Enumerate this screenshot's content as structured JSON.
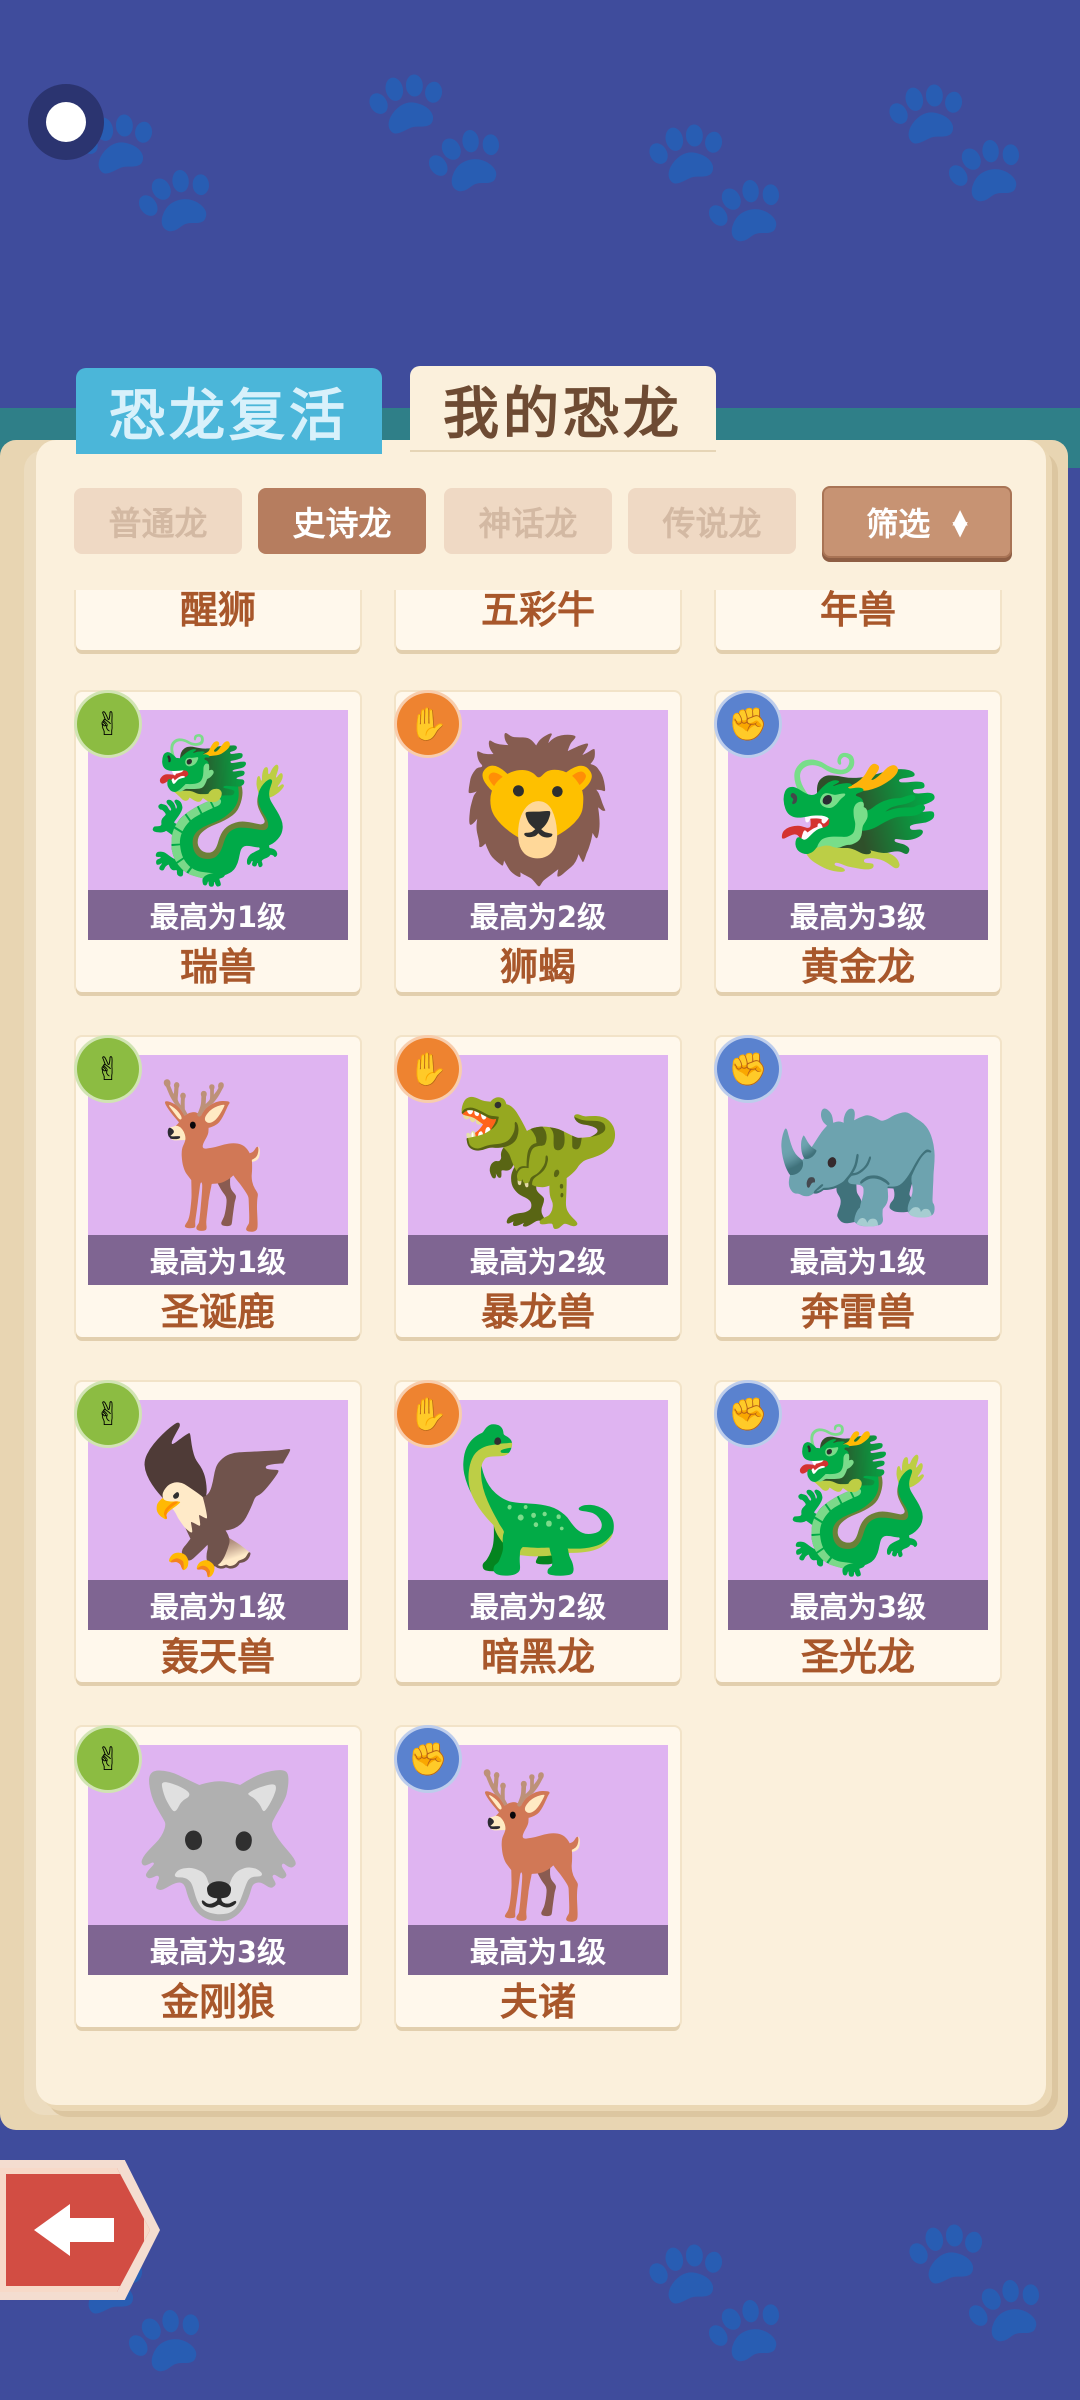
{
  "tabs": {
    "revive": "恐龙复活",
    "mine": "我的恐龙"
  },
  "subtabs": [
    "普通龙",
    "史诗龙",
    "神话龙",
    "传说龙"
  ],
  "active_subtab": "史诗龙",
  "filter_label": "筛选",
  "partial_row": [
    "醒狮",
    "五彩牛",
    "年兽"
  ],
  "cards": [
    {
      "name": "瑞兽",
      "level": "最高为1级",
      "type": "scissors",
      "icon": "🐉"
    },
    {
      "name": "狮蝎",
      "level": "最高为2级",
      "type": "paper",
      "icon": "🦁"
    },
    {
      "name": "黄金龙",
      "level": "最高为3级",
      "type": "rock",
      "icon": "🐲"
    },
    {
      "name": "圣诞鹿",
      "level": "最高为1级",
      "type": "scissors",
      "icon": "🦌"
    },
    {
      "name": "暴龙兽",
      "level": "最高为2级",
      "type": "paper",
      "icon": "🦖"
    },
    {
      "name": "奔雷兽",
      "level": "最高为1级",
      "type": "rock",
      "icon": "🦏"
    },
    {
      "name": "轰天兽",
      "level": "最高为1级",
      "type": "scissors",
      "icon": "🦅"
    },
    {
      "name": "暗黑龙",
      "level": "最高为2级",
      "type": "paper",
      "icon": "🦕"
    },
    {
      "name": "圣光龙",
      "level": "最高为3级",
      "type": "rock",
      "icon": "🐉"
    },
    {
      "name": "金刚狼",
      "level": "最高为3级",
      "type": "scissors",
      "icon": "🐺"
    },
    {
      "name": "夫诸",
      "level": "最高为1级",
      "type": "rock",
      "icon": "🦌"
    }
  ],
  "badge_icons": {
    "scissors": "✌",
    "paper": "✋",
    "rock": "✊"
  },
  "colors": {
    "background": "#3f4c9c",
    "card_art": "#dfb4f1",
    "active_subtab": "#b67d5f"
  }
}
